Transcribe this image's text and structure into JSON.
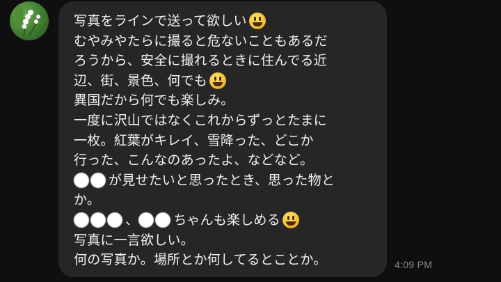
{
  "contact": {
    "avatar_icon": "lily-of-the-valley-avatar"
  },
  "message": {
    "lines": [
      {
        "text": "写真をラインで送って欲しい",
        "emoji": "smiley-emoji"
      },
      {
        "text": "むやみやたらに撮ると危ないこともあるだ"
      },
      {
        "text": "ろうから、安全に撮れるときに住んでる近"
      },
      {
        "text": "辺、街、景色、何でも",
        "emoji": "smiley-emoji"
      },
      {
        "text": "異国だから何でも楽しみ。"
      },
      {
        "text": "一度に沢山ではなくこれからずっとたまに"
      },
      {
        "text": "一枚。紅葉がキレイ、雪降った、どこか"
      },
      {
        "text": "行った、こんなのあったよ、などなど。"
      },
      {
        "text": "が見せたいと思ったとき、思った物と"
      },
      {
        "text": "か。"
      },
      {
        "text_a": "、",
        "text_b": "ちゃんも楽しめる",
        "emoji": "smiley-emoji"
      },
      {
        "text": "写真に一言欲しい。"
      },
      {
        "text": "何の写真か。場所とか何してるとことか。"
      }
    ],
    "timestamp": "4:09 PM"
  },
  "colors": {
    "background": "#0f0f0f",
    "bubble": "#262626",
    "text": "#f2f2f2",
    "timestamp": "#8a8a8a"
  }
}
